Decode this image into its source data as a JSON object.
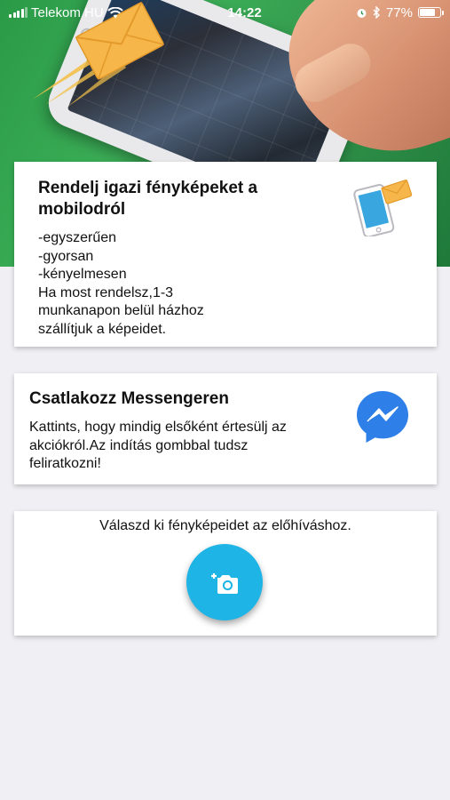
{
  "status_bar": {
    "carrier": "Telekom HU",
    "time": "14:22",
    "battery_percent": "77%",
    "battery_level": 0.77,
    "icons": [
      "signal-icon",
      "wifi-icon",
      "alarm-icon",
      "bluetooth-icon",
      "battery-icon"
    ]
  },
  "order_card": {
    "title": "Rendelj igazi fényképeket a mobilodról",
    "lines": [
      "-egyszerűen",
      "-gyorsan",
      "-kényelmesen",
      "Ha most rendelsz,1-3",
      "munkanapon belül házhoz",
      "szállítjuk a képeidet."
    ],
    "icon": "phone-mail-icon"
  },
  "messenger_card": {
    "title": "Csatlakozz Messengeren",
    "lines": [
      "Kattints, hogy mindig elsőként értesülj az",
      "akciókról.Az indítás gombbal tudsz",
      "feliratkozni!"
    ],
    "icon": "messenger-icon"
  },
  "upload_card": {
    "text": "Válaszd ki fényképeidet az előhíváshoz.",
    "button_icon": "add-photo-camera-icon"
  },
  "colors": {
    "background": "#efeff4",
    "hero_green": "#2e9c4a",
    "accent_blue": "#1fb4e6",
    "messenger_blue": "#2f7fe8"
  }
}
